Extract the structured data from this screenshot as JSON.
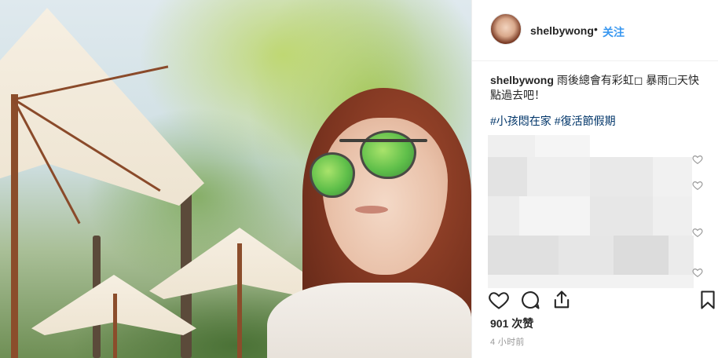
{
  "post": {
    "username": "shelbywong",
    "separator": "•",
    "follow_label": "关注",
    "caption_user": "shelbywong",
    "caption_text": "雨後總會有彩虹◻ 暴雨◻天快點過去吧！",
    "hashtags": [
      "#小孩悶在家",
      "#復活節假期"
    ],
    "likes_text": "901 次赞",
    "time_text": "4 小时前"
  },
  "icons": {
    "like": "heart-icon",
    "comment": "comment-icon",
    "share": "share-icon",
    "save": "bookmark-icon",
    "comment_like": "small-heart-icon"
  },
  "colors": {
    "link_blue": "#3897f0",
    "hashtag_blue": "#003569",
    "text": "#262626",
    "muted": "#999999"
  }
}
